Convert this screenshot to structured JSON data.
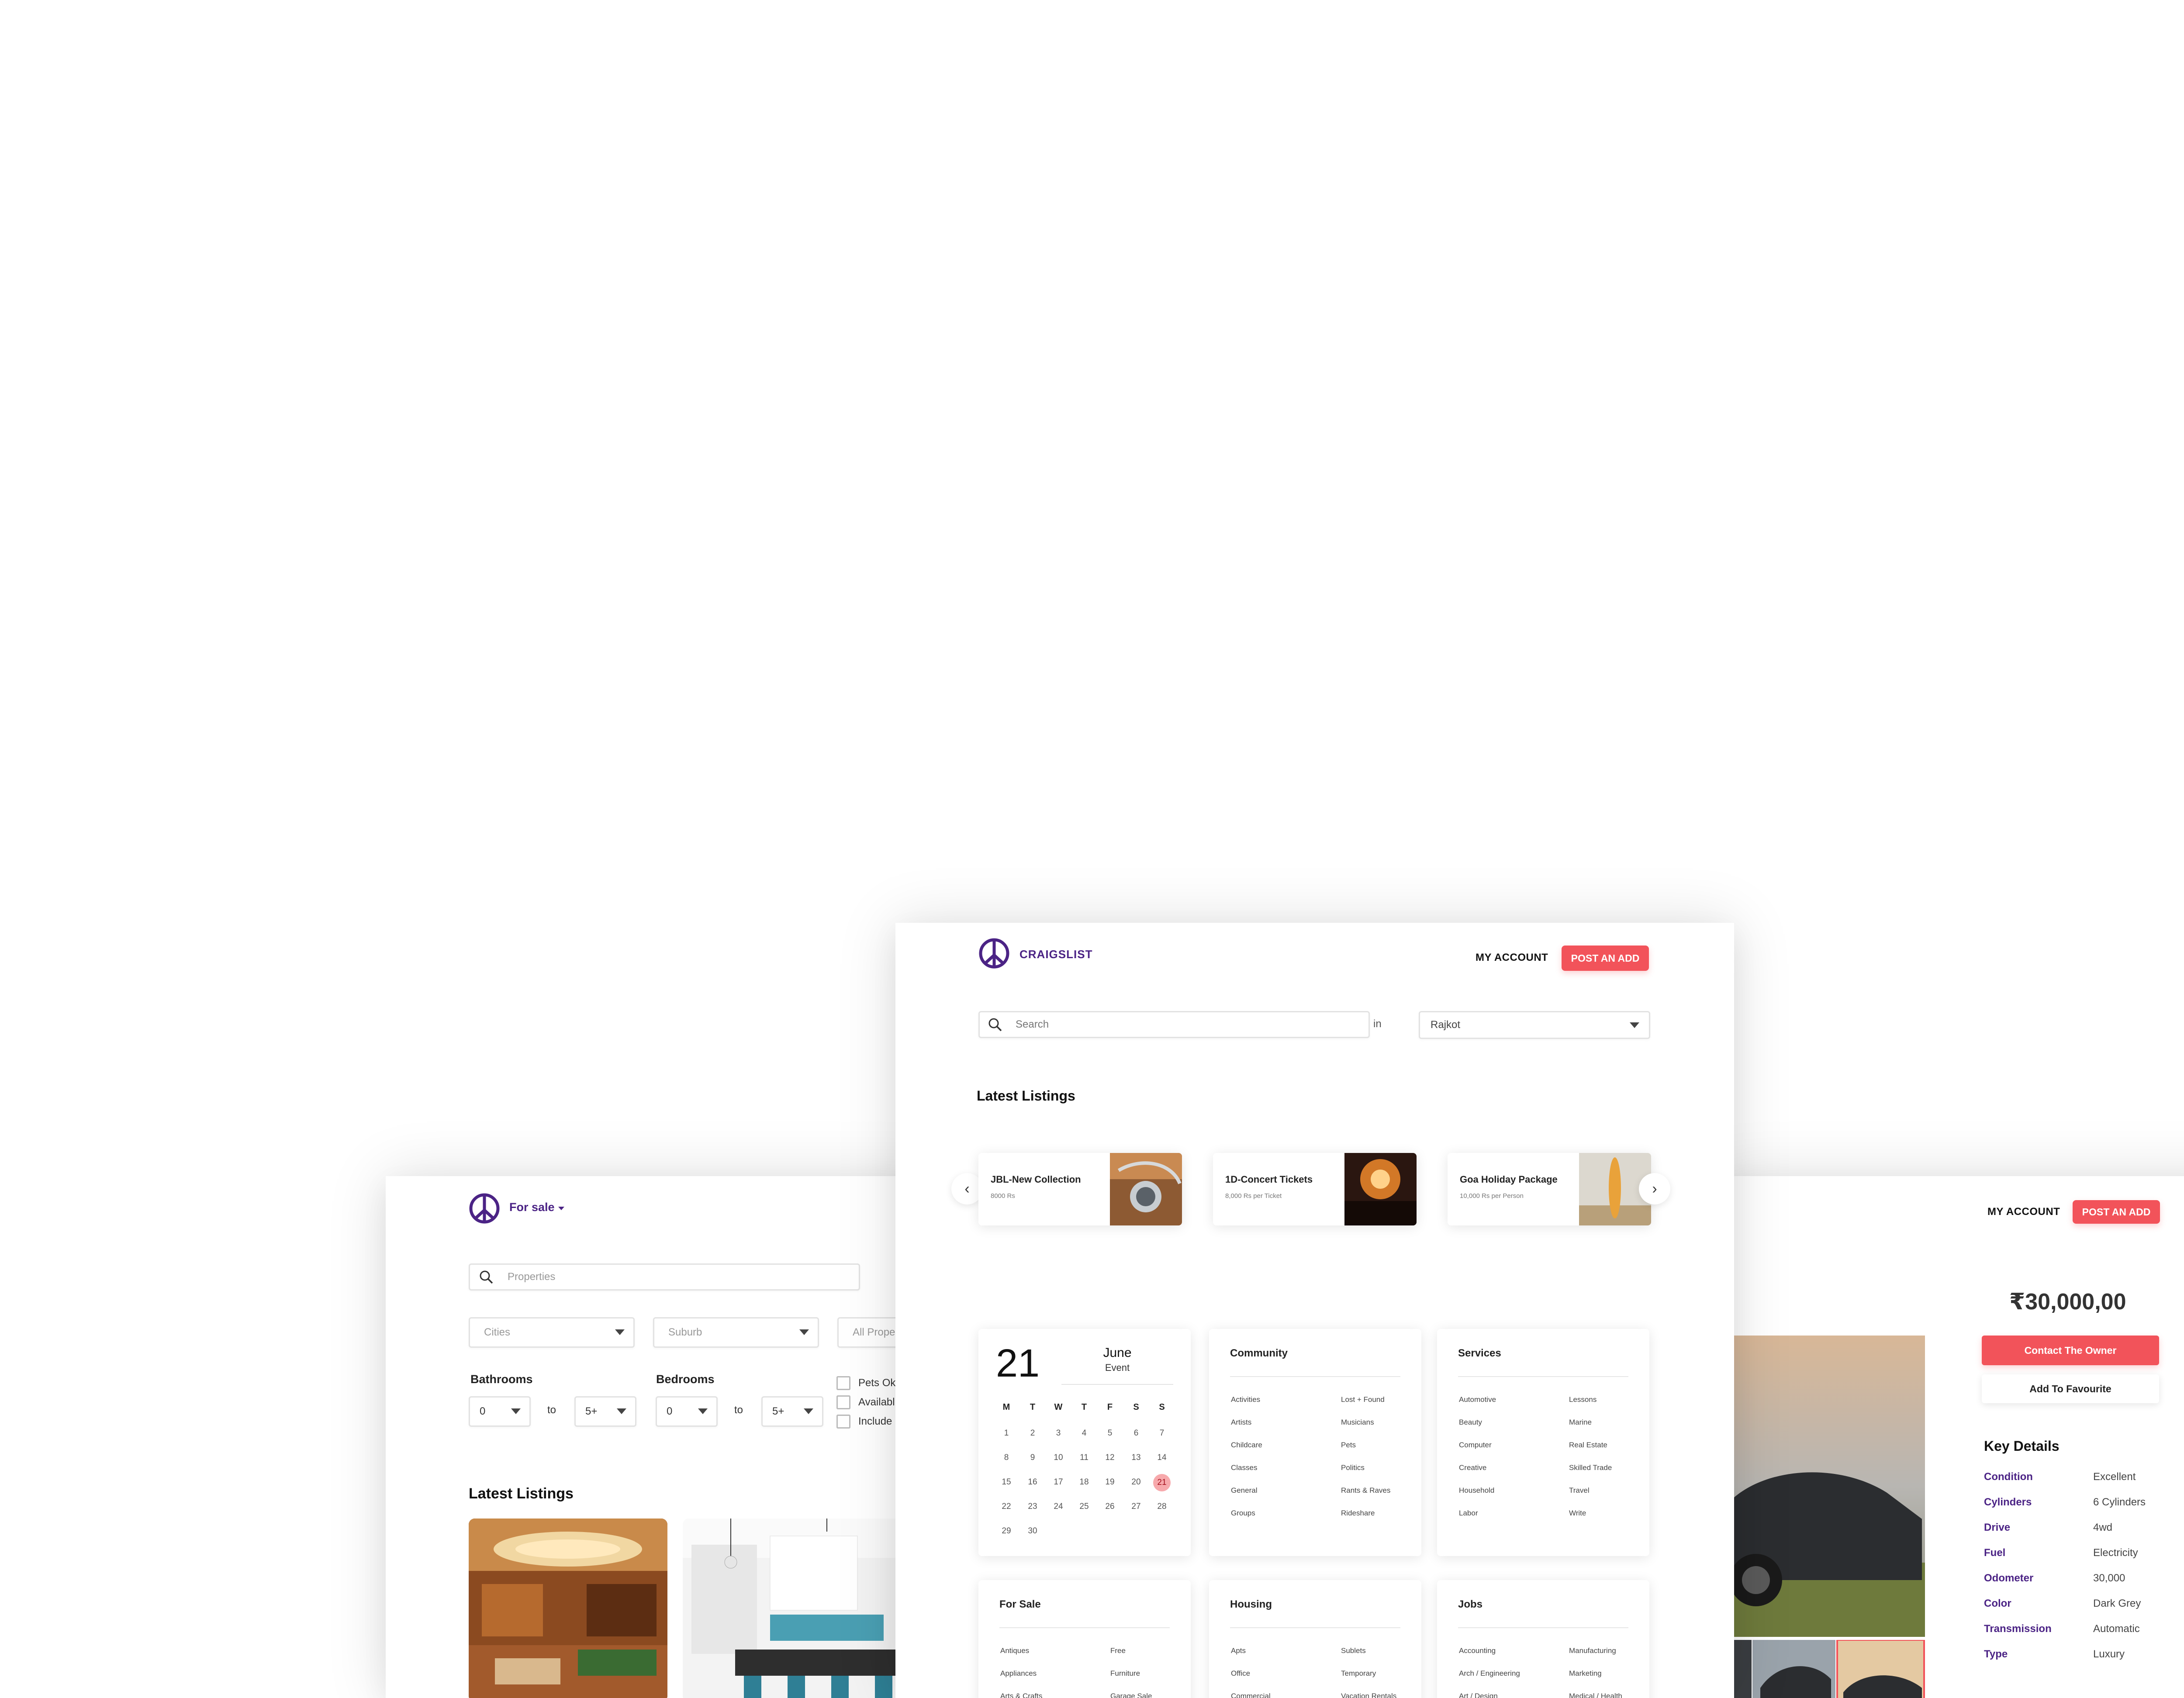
{
  "colors": {
    "brand_purple": "#4b2385",
    "accent_red": "#f2535a",
    "calendar_highlight": "#f7a9ac"
  },
  "left_window": {
    "logo_icon": "peace-icon",
    "category_dropdown": "For sale",
    "search_placeholder": "Properties",
    "filters": {
      "cities_placeholder": "Cities",
      "suburb_placeholder": "Suburb",
      "property_type_placeholder": "All Prope"
    },
    "bathrooms": {
      "label": "Bathrooms",
      "from": "0",
      "to_word": "to",
      "to": "5+"
    },
    "bedrooms": {
      "label": "Bedrooms",
      "from": "0",
      "to_word": "to",
      "to": "5+"
    },
    "checkboxes": [
      "Pets Ok",
      "Availabl",
      "Include"
    ],
    "latest_listings_title": "Latest Listings"
  },
  "main_window": {
    "logo_icon": "peace-icon",
    "brand": "CRAIGSLIST",
    "nav": {
      "my_account": "MY ACCOUNT",
      "post_ad": "POST AN ADD"
    },
    "search": {
      "placeholder": "Search",
      "in_word": "in",
      "location": "Rajkot"
    },
    "latest_listings_title": "Latest Listings",
    "listings": [
      {
        "title": "JBL-New Collection",
        "price": "8000 Rs"
      },
      {
        "title": "1D-Concert Tickets",
        "price": "8,000 Rs per Ticket"
      },
      {
        "title": "Goa Holiday Package",
        "price": "10,000 Rs per Person"
      }
    ],
    "calendar": {
      "day": "21",
      "month": "June",
      "caption": "Event",
      "dow": [
        "M",
        "T",
        "W",
        "T",
        "F",
        "S",
        "S"
      ],
      "weeks": [
        [
          "1",
          "2",
          "3",
          "4",
          "5",
          "6",
          "7"
        ],
        [
          "8",
          "9",
          "10",
          "11",
          "12",
          "13",
          "14"
        ],
        [
          "15",
          "16",
          "17",
          "18",
          "19",
          "20",
          "21"
        ],
        [
          "22",
          "23",
          "24",
          "25",
          "26",
          "27",
          "28"
        ],
        [
          "29",
          "30"
        ]
      ],
      "highlighted": "21"
    },
    "categories": {
      "community": {
        "title": "Community",
        "col1": [
          "Activities",
          "Artists",
          "Childcare",
          "Classes",
          "General",
          "Groups"
        ],
        "col2": [
          "Lost + Found",
          "Musicians",
          "Pets",
          "Politics",
          "Rants & Raves",
          "Rideshare"
        ]
      },
      "services": {
        "title": "Services",
        "col1": [
          "Automotive",
          "Beauty",
          "Computer",
          "Creative",
          "Household",
          "Labor"
        ],
        "col2": [
          "Lessons",
          "Marine",
          "Real Estate",
          "Skilled Trade",
          "Travel",
          "Write"
        ]
      },
      "for_sale": {
        "title": "For Sale",
        "col1": [
          "Antiques",
          "Appliances",
          "Arts & Crafts"
        ],
        "col2": [
          "Free",
          "Furniture",
          "Garage Sale"
        ]
      },
      "housing": {
        "title": "Housing",
        "col1": [
          "Apts",
          "Office",
          "Commercial"
        ],
        "col2": [
          "Sublets",
          "Temporary",
          "Vacation Rentals"
        ]
      },
      "jobs": {
        "title": "Jobs",
        "col1": [
          "Accounting",
          "Arch / Engineering",
          "Art / Design"
        ],
        "col2": [
          "Manufacturing",
          "Marketing",
          "Medical / Health"
        ]
      }
    }
  },
  "right_window": {
    "nav": {
      "my_account": "MY ACCOUNT",
      "post_ad": "POST AN ADD"
    },
    "price": "₹30,000,00",
    "contact_button": "Contact The Owner",
    "favourite_button": "Add To Favourite",
    "key_details_title": "Key Details",
    "key_details": [
      {
        "label": "Condition",
        "value": "Excellent"
      },
      {
        "label": "Cylinders",
        "value": "6 Cylinders"
      },
      {
        "label": "Drive",
        "value": "4wd"
      },
      {
        "label": "Fuel",
        "value": "Electricity"
      },
      {
        "label": "Odometer",
        "value": "30,000"
      },
      {
        "label": "Color",
        "value": "Dark Grey"
      },
      {
        "label": "Transmission",
        "value": "Automatic"
      },
      {
        "label": "Type",
        "value": "Luxury"
      }
    ]
  }
}
